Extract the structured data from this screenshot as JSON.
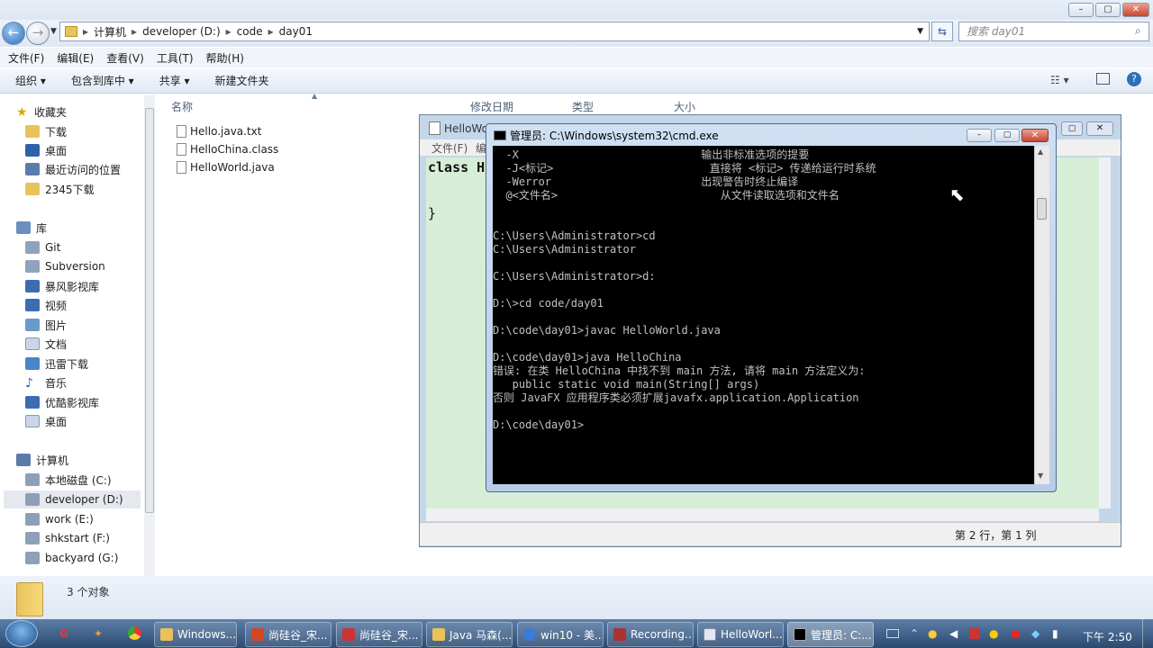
{
  "explorer": {
    "breadcrumb": [
      "计算机",
      "developer (D:)",
      "code",
      "day01"
    ],
    "search_placeholder": "搜索 day01",
    "menu": [
      "文件(F)",
      "编辑(E)",
      "查看(V)",
      "工具(T)",
      "帮助(H)"
    ],
    "toolbar": [
      "组织 ▾",
      "包含到库中 ▾",
      "共享 ▾",
      "新建文件夹"
    ],
    "columns": [
      "名称",
      "修改日期",
      "类型",
      "大小"
    ],
    "files": [
      "Hello.java.txt",
      "HelloChina.class",
      "HelloWorld.java"
    ],
    "status_count": "3 个对象"
  },
  "sidebar": {
    "favorites_header": "收藏夹",
    "favorites": [
      "下载",
      "桌面",
      "最近访问的位置",
      "2345下载"
    ],
    "libraries_header": "库",
    "libraries": [
      "Git",
      "Subversion",
      "暴风影视库",
      "视频",
      "图片",
      "文档",
      "迅雷下载",
      "音乐",
      "优酷影视库",
      "桌面"
    ],
    "computer_header": "计算机",
    "drives": [
      "本地磁盘 (C:)",
      "developer (D:)",
      "work (E:)",
      "shkstart (F:)",
      "backyard (G:)"
    ]
  },
  "notepad": {
    "title": "HelloWo",
    "menu": [
      "文件(F)",
      "编"
    ],
    "code_line1": "class H",
    "code_line2": "}",
    "status": "第 2 行，第 1 列"
  },
  "cmd": {
    "title": "管理员: C:\\Windows\\system32\\cmd.exe",
    "lines": [
      "  -X                            输出非标准选项的提要",
      "  -J<标记>                        直接将 <标记> 传递给运行时系统",
      "  -Werror                       出现警告时终止编译",
      "  @<文件名>                         从文件读取选项和文件名",
      "",
      "",
      "C:\\Users\\Administrator>cd",
      "C:\\Users\\Administrator",
      "",
      "C:\\Users\\Administrator>d:",
      "",
      "D:\\>cd code/day01",
      "",
      "D:\\code\\day01>javac HelloWorld.java",
      "",
      "D:\\code\\day01>java HelloChina",
      "错误: 在类 HelloChina 中找不到 main 方法, 请将 main 方法定义为:",
      "   public static void main(String[] args)",
      "否则 JavaFX 应用程序类必须扩展javafx.application.Application",
      "",
      "D:\\code\\day01>"
    ]
  },
  "taskbar": {
    "items": [
      "Windows...",
      "尚硅谷_宋...",
      "尚硅谷_宋...",
      "Java 马森(...",
      "win10 - 美...",
      "Recording...",
      "HelloWorl...",
      "管理员: C:..."
    ],
    "clock": "下午 2:50"
  },
  "colors": {
    "accent": "#2c4a70",
    "cmd_bg": "#000000",
    "notepad_bg": "#d6eed6"
  }
}
